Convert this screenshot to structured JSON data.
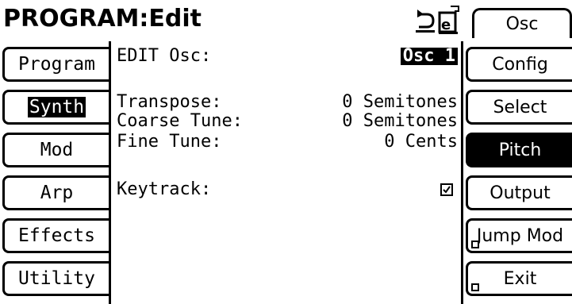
{
  "header": {
    "title": "PROGRAM:Edit",
    "icons": [
      "undo-icon",
      "edit-page-icon"
    ]
  },
  "left_tabs": [
    {
      "label": "Program",
      "active": false
    },
    {
      "label": "Synth",
      "active": true
    },
    {
      "label": "Mod",
      "active": false
    },
    {
      "label": "Arp",
      "active": false
    },
    {
      "label": "Effects",
      "active": false
    },
    {
      "label": "Utility",
      "active": false
    }
  ],
  "edit_osc": {
    "label": "EDIT Osc:",
    "value": "Osc 1"
  },
  "params": {
    "transpose": {
      "label": "Transpose:",
      "value": "0 Semitones"
    },
    "coarse_tune": {
      "label": "Coarse Tune:",
      "value": "0 Semitones"
    },
    "fine_tune": {
      "label": "Fine Tune:",
      "value": "0 Cents"
    },
    "keytrack": {
      "label": "Keytrack:",
      "checked": true
    }
  },
  "right_tabs": {
    "top": {
      "label": "Osc"
    },
    "items": [
      {
        "label": "Config",
        "active": false
      },
      {
        "label": "Select",
        "active": false
      },
      {
        "label": "Pitch",
        "active": true
      },
      {
        "label": "Output",
        "active": false
      },
      {
        "label": "Jump Mod",
        "active": false
      },
      {
        "label": "Exit",
        "active": false
      }
    ]
  },
  "colors": {
    "foreground": "#000000",
    "background": "#ffffff"
  }
}
